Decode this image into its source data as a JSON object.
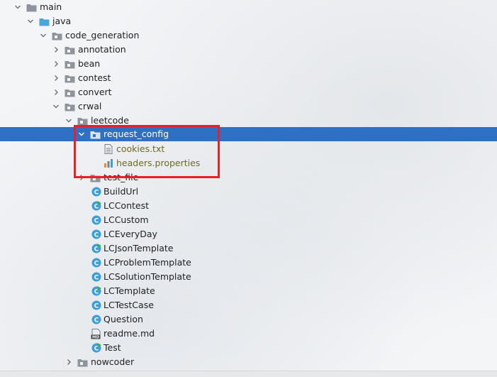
{
  "tree": {
    "main": "main",
    "java": "java",
    "code_generation": "code_generation",
    "annotation": "annotation",
    "bean": "bean",
    "contest": "contest",
    "convert": "convert",
    "crwal": "crwal",
    "leetcode": "leetcode",
    "request_config": "request_config",
    "cookies": "cookies.txt",
    "headers": "headers.properties",
    "test_file": "test_file",
    "files": [
      "BuildUrl",
      "LCContest",
      "LCCustom",
      "LCEveryDay",
      "LCJsonTemplate",
      "LCProblemTemplate",
      "LCSolutionTemplate",
      "LCTemplate",
      "LCTestCase",
      "Question",
      "readme.md",
      "Test"
    ],
    "nowcoder": "nowcoder"
  },
  "colors": {
    "selection": "#2f6fc4",
    "highlight_box": "#e8202a",
    "class_icon": "#3c9fd6",
    "folder_icon": "#8e949c",
    "resource_text": "#6f6a1d"
  },
  "icons": {
    "expanded": "chevron-down-icon",
    "collapsed": "chevron-right-icon",
    "folder": "folder-icon",
    "class": "class-icon",
    "text_file": "text-file-icon",
    "properties_file": "properties-file-icon",
    "markdown_file": "markdown-file-icon"
  }
}
